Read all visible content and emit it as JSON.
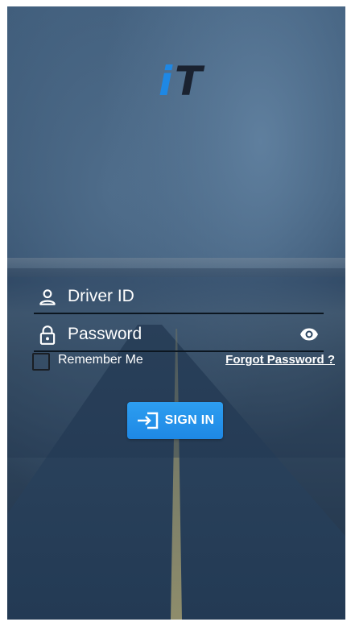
{
  "logo": {
    "letter_i": "i",
    "letter_t": "T",
    "color_i": "#1e88e5",
    "color_t": "#1a2230"
  },
  "form": {
    "driver_id": {
      "placeholder": "Driver ID",
      "value": "",
      "icon": "person-icon"
    },
    "password": {
      "placeholder": "Password",
      "value": "",
      "icon": "lock-icon",
      "toggle_icon": "eye-icon"
    },
    "remember_me": {
      "label": "Remember Me",
      "checked": false
    },
    "forgot_password": {
      "label": "Forgot Password ?"
    },
    "sign_in": {
      "label": "SIGN IN",
      "icon": "sign-in-icon",
      "color": "#1e88e5"
    }
  }
}
